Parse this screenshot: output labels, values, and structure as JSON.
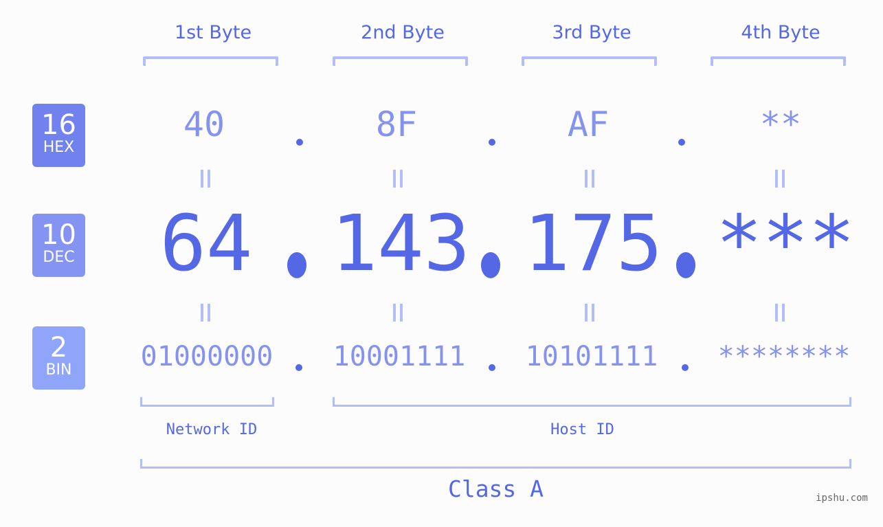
{
  "bytes": [
    {
      "title": "1st Byte",
      "hex": "40",
      "dec": "64",
      "bin": "01000000"
    },
    {
      "title": "2nd Byte",
      "hex": "8F",
      "dec": "143",
      "bin": "10001111"
    },
    {
      "title": "3rd Byte",
      "hex": "AF",
      "dec": "175",
      "bin": "10101111"
    },
    {
      "title": "4th Byte",
      "hex": "**",
      "dec": "***",
      "bin": "********"
    }
  ],
  "badges": {
    "hex": {
      "num": "16",
      "label": "HEX",
      "color": "#7181ed"
    },
    "dec": {
      "num": "10",
      "label": "DEC",
      "color": "#8594f2"
    },
    "bin": {
      "num": "2",
      "label": "BIN",
      "color": "#8fa5f9"
    }
  },
  "labels": {
    "network_id": "Network ID",
    "host_id": "Host ID",
    "class": "Class A"
  },
  "watermark": "ipshu.com",
  "colors": {
    "primary": "#5468e6",
    "light": "#8592ee",
    "bracket": "#b3bdf7"
  }
}
